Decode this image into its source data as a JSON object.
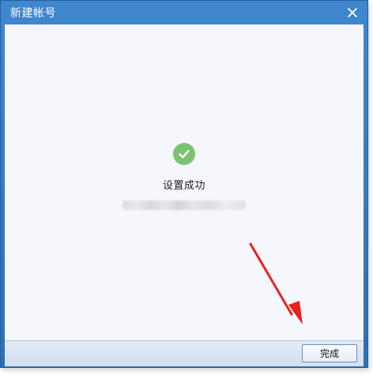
{
  "dialog": {
    "title": "新建帐号",
    "close_icon": "close-icon"
  },
  "status": {
    "icon": "check-circle-icon",
    "icon_color": "#7cc370",
    "message": "设置成功"
  },
  "annotation": {
    "icon": "red-arrow-icon",
    "color": "#e8231e"
  },
  "footer": {
    "finish_label": "完成"
  }
}
